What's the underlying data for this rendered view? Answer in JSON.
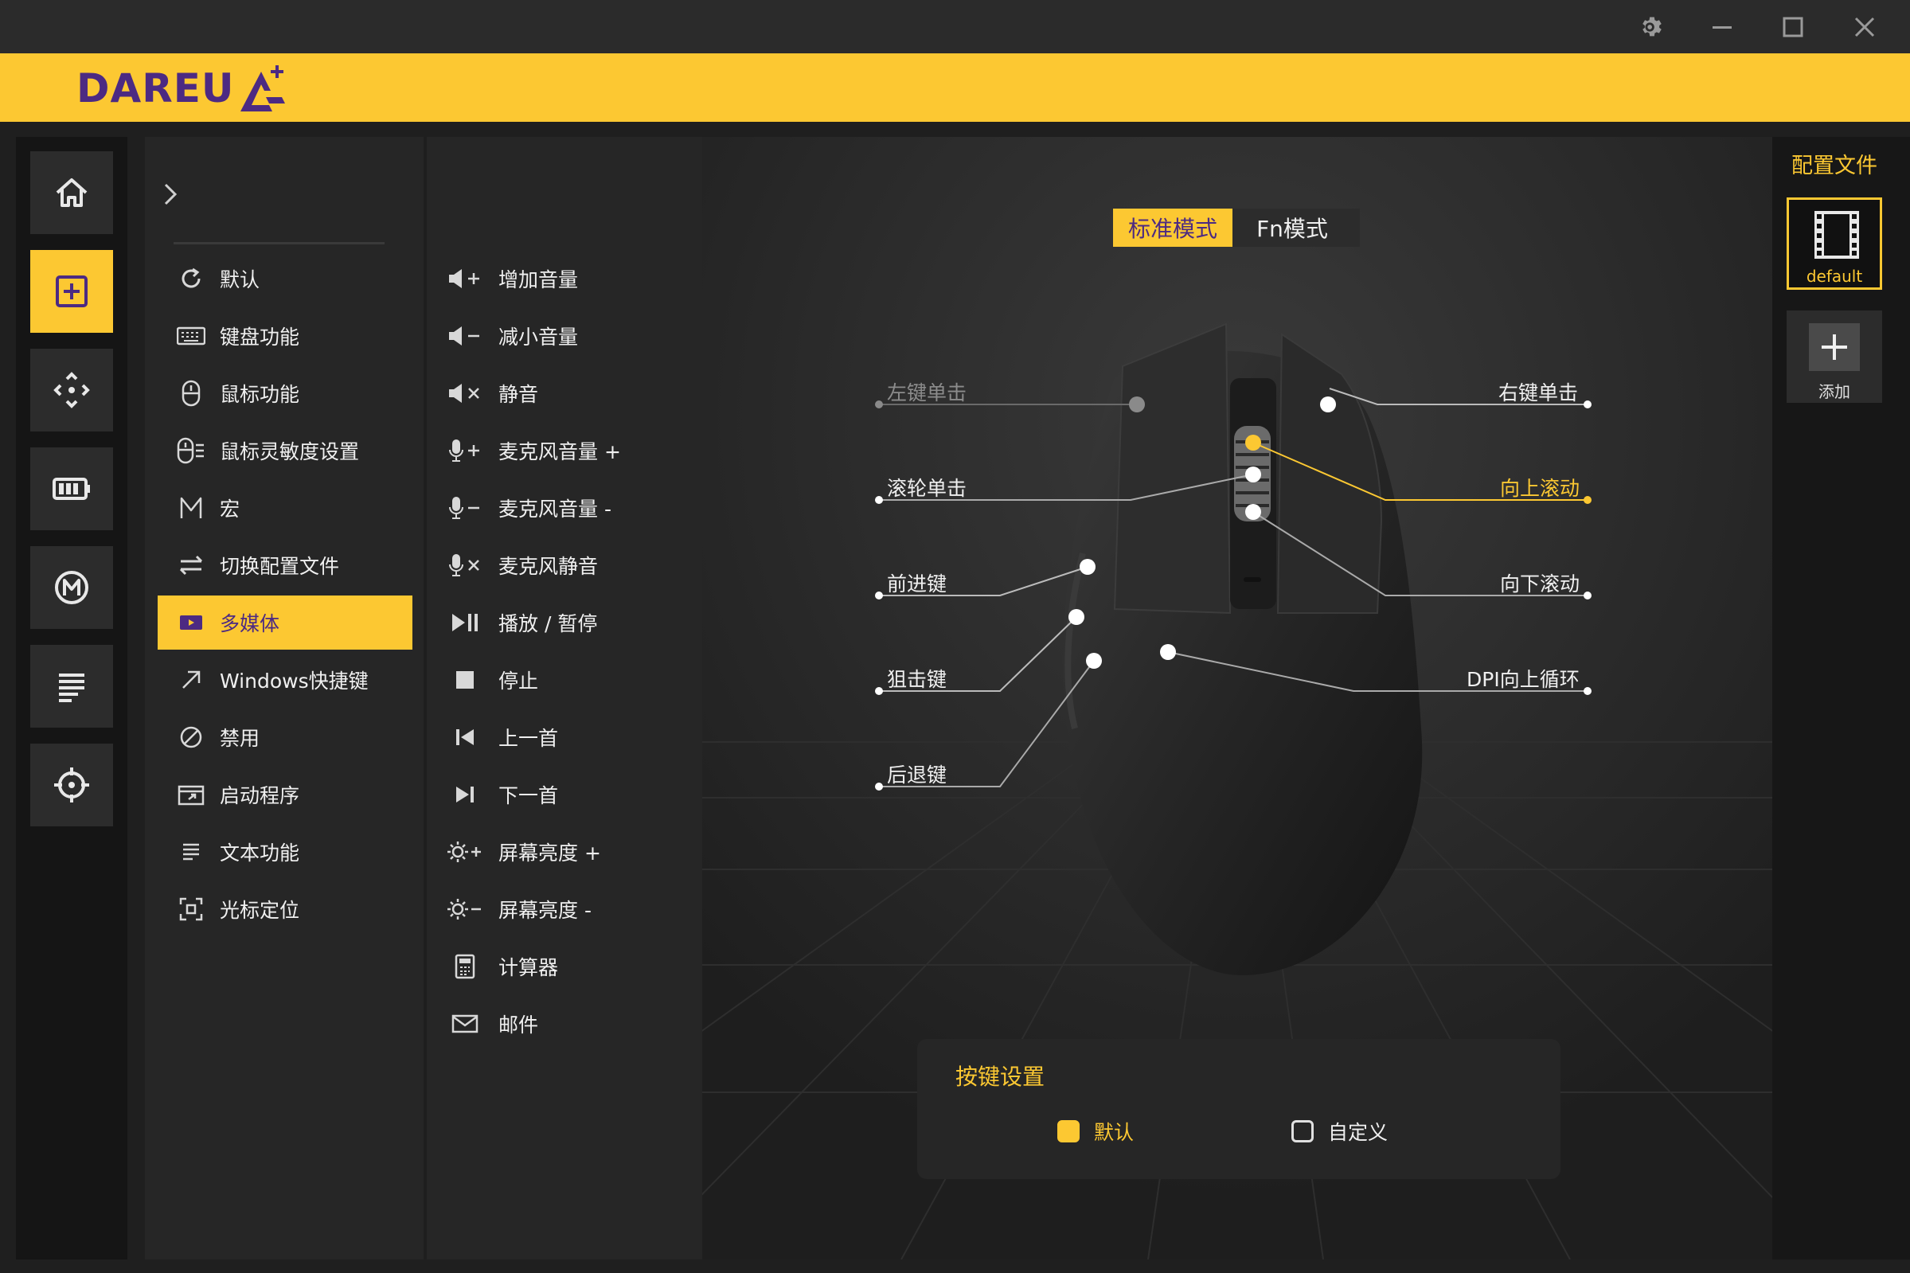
{
  "brand": {
    "name": "DAREU"
  },
  "colors": {
    "accent": "#fcc832",
    "purple": "#4c2a82",
    "bg": "#1f1f1f"
  },
  "window_controls": [
    "gear-icon",
    "minimize-icon",
    "maximize-icon",
    "close-icon"
  ],
  "left_nav": [
    "home-icon",
    "key-assign-icon",
    "move-icon",
    "battery-icon",
    "macro-icon",
    "list-icon",
    "crosshair-icon"
  ],
  "functions": [
    {
      "label": "默认",
      "icon": "reset-icon"
    },
    {
      "label": "键盘功能",
      "icon": "keyboard-icon"
    },
    {
      "label": "鼠标功能",
      "icon": "mouse-icon"
    },
    {
      "label": "鼠标灵敏度设置",
      "icon": "sensitivity-icon"
    },
    {
      "label": "宏",
      "icon": "macro-m-icon"
    },
    {
      "label": "切换配置文件",
      "icon": "switch-icon"
    },
    {
      "label": "多媒体",
      "icon": "multimedia-icon",
      "active": true
    },
    {
      "label": "Windows快捷键",
      "icon": "arrow-icon"
    },
    {
      "label": "禁用",
      "icon": "disable-icon"
    },
    {
      "label": "启动程序",
      "icon": "launch-icon"
    },
    {
      "label": "文本功能",
      "icon": "text-icon"
    },
    {
      "label": "光标定位",
      "icon": "cursor-pos-icon"
    }
  ],
  "multimedia": [
    {
      "label": "增加音量",
      "icon": "volume-up-icon"
    },
    {
      "label": "减小音量",
      "icon": "volume-down-icon"
    },
    {
      "label": "静音",
      "icon": "mute-icon"
    },
    {
      "label": "麦克风音量 +",
      "icon": "mic-up-icon"
    },
    {
      "label": "麦克风音量 -",
      "icon": "mic-down-icon"
    },
    {
      "label": "麦克风静音",
      "icon": "mic-mute-icon"
    },
    {
      "label": "播放 / 暂停",
      "icon": "play-pause-icon"
    },
    {
      "label": "停止",
      "icon": "stop-icon"
    },
    {
      "label": "上一首",
      "icon": "prev-icon"
    },
    {
      "label": "下一首",
      "icon": "next-icon"
    },
    {
      "label": "屏幕亮度 +",
      "icon": "brightness-up-icon"
    },
    {
      "label": "屏幕亮度 -",
      "icon": "brightness-down-icon"
    },
    {
      "label": "计算器",
      "icon": "calculator-icon"
    },
    {
      "label": "邮件",
      "icon": "mail-icon"
    }
  ],
  "modes": {
    "standard": "标准模式",
    "fn": "Fn模式"
  },
  "mouse_labels": {
    "left_click": "左键单击",
    "wheel_click": "滚轮单击",
    "forward": "前进键",
    "sniper": "狙击键",
    "back": "后退键",
    "right_click": "右键单击",
    "scroll_up": "向上滚动",
    "scroll_down": "向下滚动",
    "dpi_up": "DPI向上循环"
  },
  "key_settings": {
    "title": "按键设置",
    "default": "默认",
    "custom": "自定义",
    "selected": "default"
  },
  "profiles": {
    "title": "配置文件",
    "items": [
      "default"
    ],
    "add_label": "添加"
  }
}
